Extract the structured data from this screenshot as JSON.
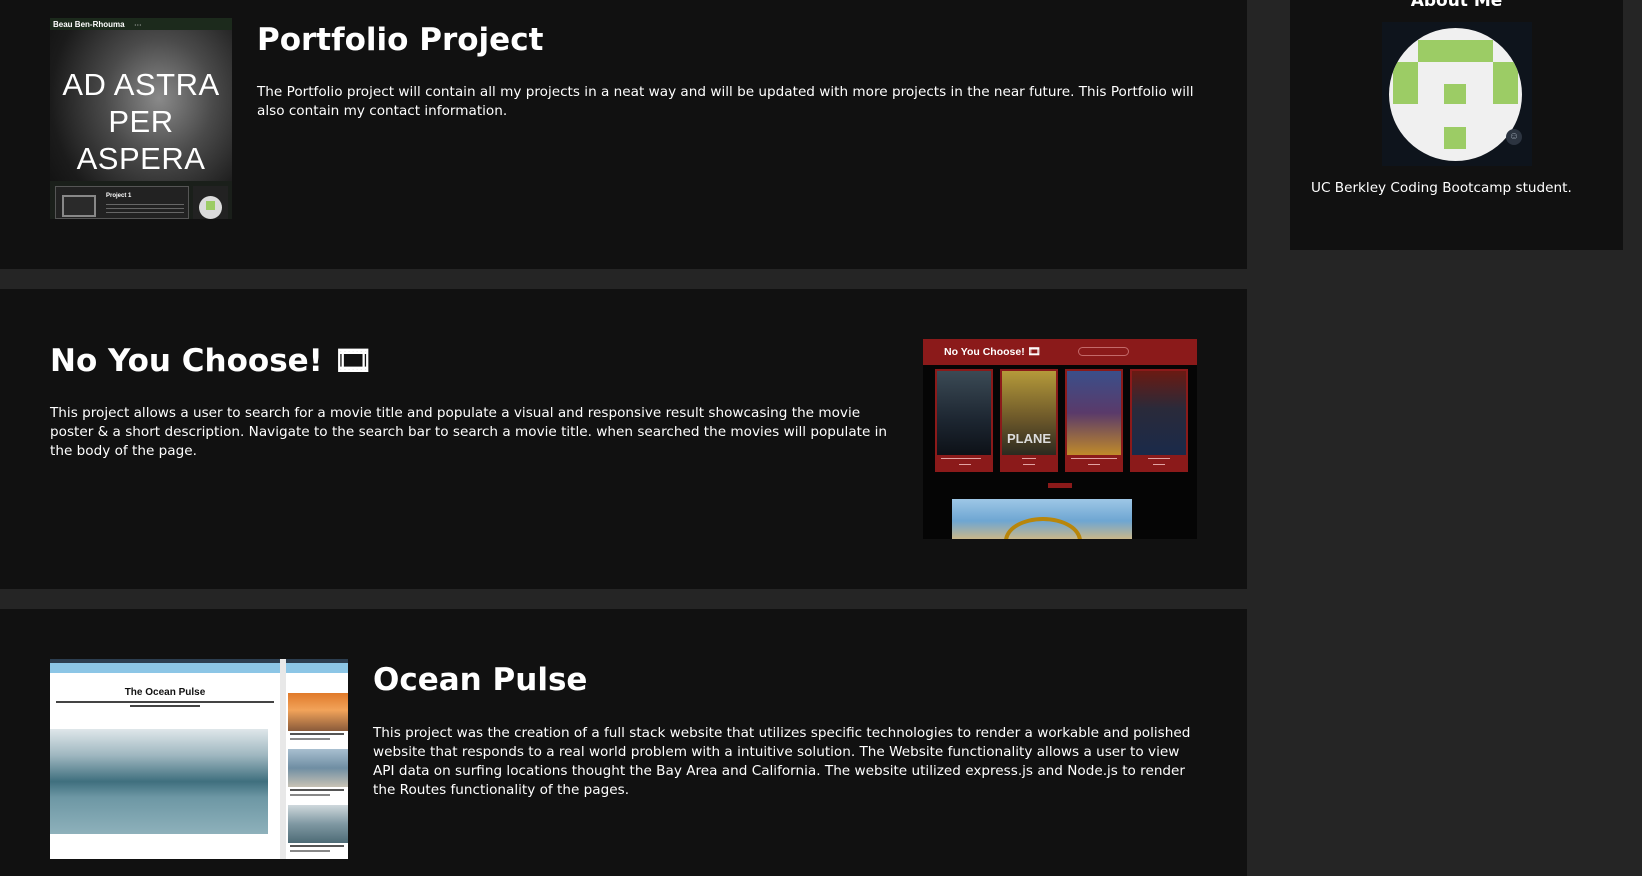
{
  "projects": {
    "portfolio": {
      "title": "Portfolio Project",
      "description": "The Portfolio project will contain all my projects in a neat way and will be updated with more projects in the near future. This Portfolio will also contain my contact information.",
      "thumbnail": {
        "site_name": "Beau Ben-Rhouma",
        "motto_line1": "AD ASTRA",
        "motto_line2": "PER ASPERA",
        "project_label": "Project 1",
        "about_label": "About Me"
      }
    },
    "no_you_choose": {
      "title": "No You Choose! 🎞",
      "description": "This project allows a user to search for a movie title and populate a visual and responsive result showcasing the movie poster & a short description. Navigate to the search bar to search a movie title. when searched the movies will populate in the body of the page.",
      "thumbnail": {
        "header_title": "No You Choose! 🎞",
        "poster_word": "PLANE"
      }
    },
    "ocean_pulse": {
      "title": "Ocean Pulse",
      "description": "This project was the creation of a full stack website that utilizes specific technologies to render a workable and polished website that responds to a real world problem with a intuitive solution. The Website functionality allows a user to view API data on surfing locations thought the Bay Area and California. The website utilized express.js and Node.js to render the Routes functionality of the pages.",
      "thumbnail": {
        "site_title": "The Ocean Pulse",
        "side_captions": [
          "Sunset",
          "Ocean Beach",
          "Belmont Beach"
        ]
      }
    }
  },
  "about": {
    "title": "About Me",
    "bio": "UC Berkley Coding Bootcamp student.",
    "avatar_icon": "identicon-avatar",
    "avatar_color": "#9ccc65"
  },
  "colors": {
    "page_bg": "#252525",
    "card_bg": "#111111",
    "movie_accent": "#8b1a1a"
  }
}
